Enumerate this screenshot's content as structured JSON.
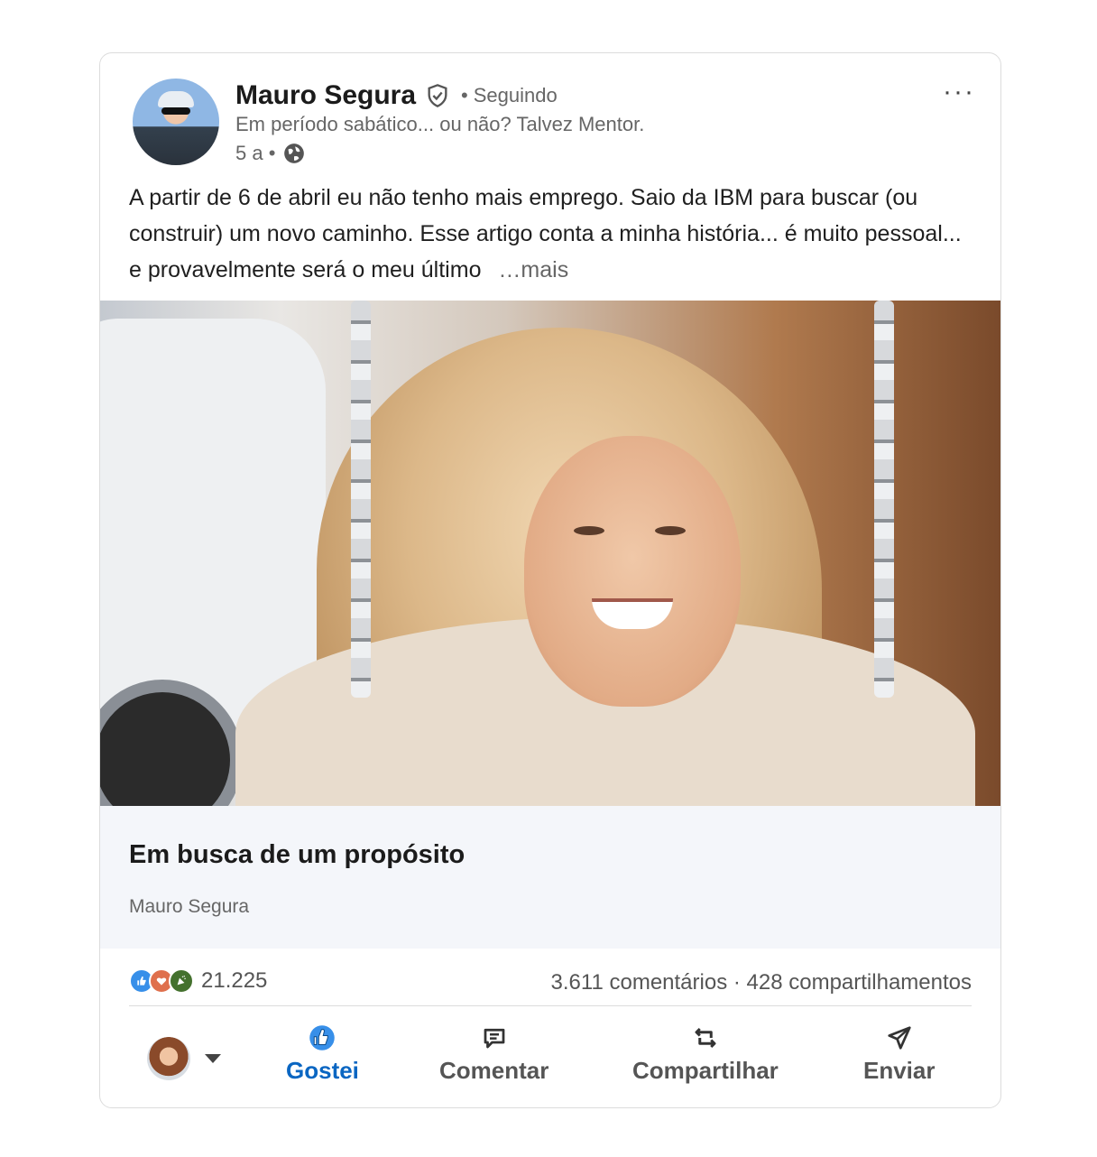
{
  "post": {
    "author_name": "Mauro Segura",
    "follow_status": "Seguindo",
    "separator": "•",
    "headline": "Em período sabático... ou não? Talvez Mentor.",
    "time": "5 a •",
    "menu_label": "···",
    "text": "A partir de 6 de abril eu não tenho mais emprego. Saio da IBM para buscar (ou construir) um novo caminho. Esse artigo conta a minha história... é muito pessoal... e provavelmente será o meu último",
    "see_more": "…mais"
  },
  "article": {
    "title": "Em busca de um propósito",
    "author": "Mauro Segura"
  },
  "social": {
    "reactions_count": "21.225",
    "comments_shares": "3.611 comentários · 428 compartilhamentos"
  },
  "actions": {
    "like": "Gostei",
    "comment": "Comentar",
    "repost": "Compartilhar",
    "send": "Enviar"
  },
  "colors": {
    "accent": "#0a66c2",
    "muted_text": "#666666",
    "article_bg": "#f4f6fa"
  }
}
